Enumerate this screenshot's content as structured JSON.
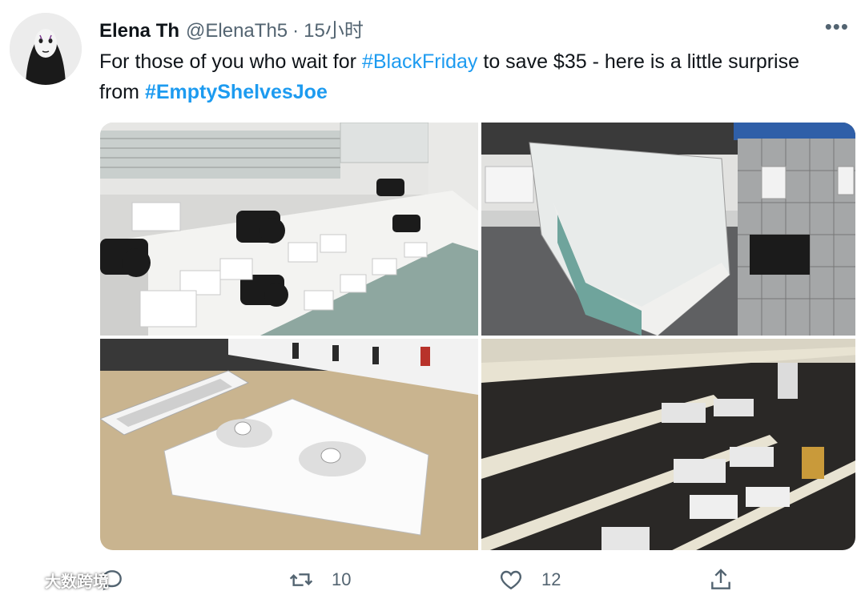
{
  "author": {
    "name": "Elena Th",
    "handle": "@ElenaTh5",
    "separator": "·",
    "time": "15小时"
  },
  "more_label": "•••",
  "tweet": {
    "part1": "For those of you who wait for ",
    "hashtag1": "#BlackFriday",
    "part2": " to save $35 - here is a little surprise from ",
    "hashtag2": "#EmptyShelvesJoe"
  },
  "photos": [
    {
      "description_icon": "camera-display-icon"
    },
    {
      "description_icon": "empty-display-case-icon"
    },
    {
      "description_icon": "watch-display-icon"
    },
    {
      "description_icon": "empty-shelves-icon"
    }
  ],
  "actions": {
    "retweet_count": "10",
    "like_count": "12"
  },
  "watermark": "大数跨境",
  "colors": {
    "link": "#1d9bf0",
    "muted": "#536471",
    "text": "#0f1419"
  }
}
